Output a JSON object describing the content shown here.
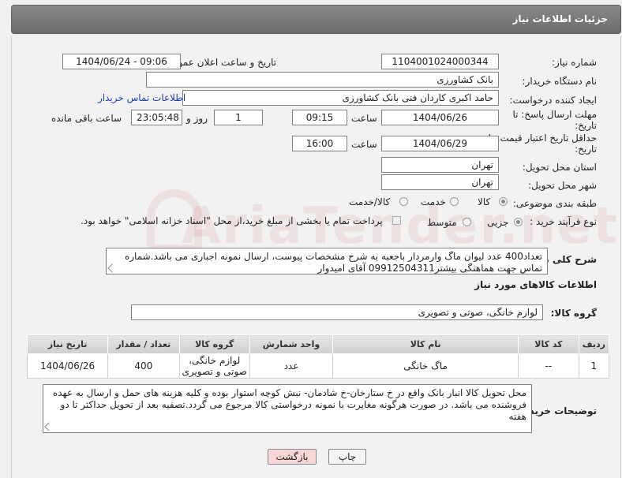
{
  "header": {
    "title": "جزئیات اطلاعات نیاز"
  },
  "form": {
    "need_number": {
      "label": "شماره نیاز:",
      "value": "1104001024000344"
    },
    "announce_datetime": {
      "label": "تاریخ و ساعت اعلان عمومی:",
      "value": "1404/06/24 - 09:06"
    },
    "buyer_org": {
      "label": "نام دستگاه خریدار:",
      "value": "بانک کشاورزی"
    },
    "requester": {
      "label": "ایجاد کننده درخواست:",
      "value": "حامد اکبری کاردان فنی بانک کشاورزی",
      "contact_link": "اطلاعات تماس خریدار"
    },
    "reply_deadline": {
      "label": "مهلت ارسال پاسخ: تا تاریخ:",
      "date": "1404/06/26",
      "time_label": "ساعت",
      "time": "09:15",
      "days": "1",
      "days_label": "روز و",
      "remaining": "23:05:48",
      "remaining_label": "ساعت باقی مانده"
    },
    "price_validity": {
      "label": "حداقل تاریخ اعتبار قیمت: تا تاریخ:",
      "date": "1404/06/29",
      "time_label": "ساعت",
      "time": "16:00"
    },
    "delivery_province": {
      "label": "استان محل تحویل:",
      "value": "تهران"
    },
    "delivery_city": {
      "label": "شهر محل تحویل:",
      "value": "تهران"
    },
    "category": {
      "label": "طبقه بندی موضوعی:",
      "options": [
        "کالا",
        "خدمت",
        "کالا/خدمت"
      ],
      "selected": "کالا"
    },
    "purchase_process": {
      "label": "نوع فرآیند خرید :",
      "options": [
        "جزیی",
        "متوسط"
      ],
      "selected": "جزیی",
      "treasury_note": "پرداخت تمام یا بخشی از مبلغ خرید،از محل \"اسناد خزانه اسلامی\" خواهد بود."
    },
    "general_desc": {
      "label": "شرح کلی نیاز:",
      "value": "تعداد400 عدد لیوان ماگ وارمردار باجعبه به شرح مشخصات پیوست، ارسال نمونه اجباری می باشد.شماره تماس جهت هماهنگی بیشتر09912504311 آقای امیدوار"
    }
  },
  "items_section": {
    "title": "اطلاعات کالاهای مورد نیاز",
    "group_label": "گروه کالا:",
    "group_value": "لوازم خانگی، صوتی و تصویری",
    "columns": [
      "ردیف",
      "کد کالا",
      "نام کالا",
      "واحد شمارش",
      "گروه کالا",
      "تعداد / مقدار",
      "تاریخ نیاز"
    ],
    "rows": [
      {
        "row": "1",
        "code": "--",
        "name": "ماگ خانگی",
        "unit": "عدد",
        "group": "لوازم خانگی، صوتی و تصویری",
        "qty": "400",
        "date": "1404/06/26"
      }
    ]
  },
  "buyer_notes": {
    "label": "توضیحات خریدار:",
    "value": "محل تحویل کالا انبار بانک واقع در خ ستارخان-خ شادمان- نبش کوچه استوار بوده و کلیه هزینه های حمل و ارسال به عهده فروشنده می باشد. در صورت هرگونه مغایرت با نمونه درخواستی کالا مرجوع می گردد.تصفیه بعد از تحویل حداکثر تا دو هفته"
  },
  "buttons": {
    "print": "چاپ",
    "back": "بازگشت"
  },
  "watermark": "AriaTender.net",
  "colors": {
    "link": "#1a3fb0",
    "back_button_bg": "#f6d6d6",
    "header_bg": "#7a7a7a"
  }
}
